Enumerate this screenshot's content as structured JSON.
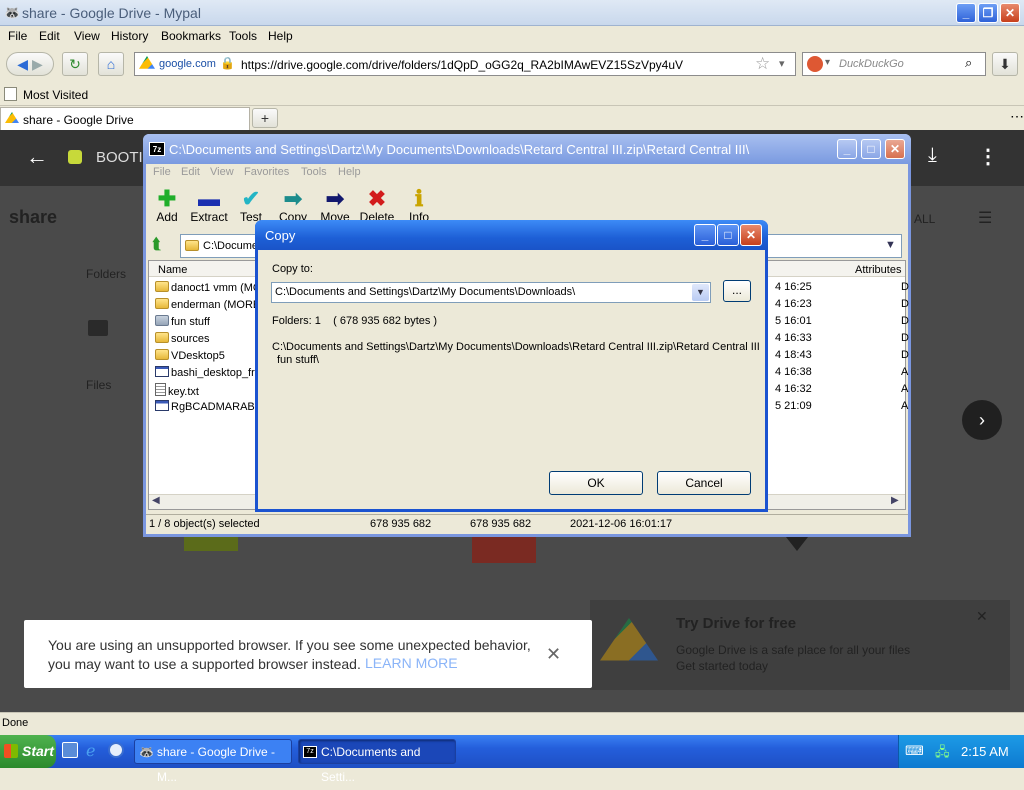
{
  "browser": {
    "window_title": "share - Google Drive - Mypal",
    "menu": [
      "File",
      "Edit",
      "View",
      "History",
      "Bookmarks",
      "Tools",
      "Help"
    ],
    "site_badge": "google.com",
    "url": "https://drive.google.com/drive/folders/1dQpD_oGG2q_RA2bIMAwEVZ15SzVpy4uV",
    "search_placeholder": "DuckDuckGo",
    "bookmark": "Most Visited",
    "tab_title": "share - Google Drive",
    "status": "Done"
  },
  "drive": {
    "folder_title": "BOOTIC",
    "page_title": "share",
    "folders_label": "Folders",
    "files_label": "Files",
    "view_all": "ALL",
    "toast_text": "You are using an unsupported browser. If you see some unexpected behavior, you may want to use a supported browser instead.",
    "toast_link": "LEARN MORE",
    "promo_title": "Try Drive for free",
    "promo_text1": "Google Drive is a safe place for all your files",
    "promo_text2": "Get started today"
  },
  "zip": {
    "title": "C:\\Documents and Settings\\Dartz\\My Documents\\Downloads\\Retard Central III.zip\\Retard Central III\\",
    "menu": [
      "File",
      "Edit",
      "View",
      "Favorites",
      "Tools",
      "Help"
    ],
    "toolbar": [
      "Add",
      "Extract",
      "Test",
      "Copy",
      "Move",
      "Delete",
      "Info"
    ],
    "address": "C:\\Docume",
    "col_name": "Name",
    "col_attributes": "Attributes",
    "rows": [
      {
        "name": "danoct1 vmm (MO",
        "date": "4 16:25",
        "attr": "D",
        "type": "folder"
      },
      {
        "name": "enderman (MORE",
        "date": "4 16:23",
        "attr": "D",
        "type": "folder"
      },
      {
        "name": "fun stuff",
        "date": "5 16:01",
        "attr": "D",
        "type": "folder"
      },
      {
        "name": "sources",
        "date": "4 16:33",
        "attr": "D",
        "type": "folder"
      },
      {
        "name": "VDesktop5",
        "date": "4 18:43",
        "attr": "D",
        "type": "folder"
      },
      {
        "name": "bashi_desktop_fre",
        "date": "4 16:38",
        "attr": "A",
        "type": "app"
      },
      {
        "name": "key.txt",
        "date": "4 16:32",
        "attr": "A",
        "type": "txt"
      },
      {
        "name": "RgBCADMARABIAI",
        "date": "5 21:09",
        "attr": "A",
        "type": "app"
      }
    ],
    "status": {
      "selected": "1 / 8 object(s) selected",
      "size": "678 935 682",
      "packed": "678 935 682",
      "modified": "2021-12-06 16:01:17"
    }
  },
  "dialog": {
    "title": "Copy",
    "copy_to_label": "Copy to:",
    "path": "C:\\Documents and Settings\\Dartz\\My Documents\\Downloads\\",
    "browse": "...",
    "folders_info": "Folders: 1    ( 678 935 682 bytes )",
    "source_line1": "C:\\Documents and Settings\\Dartz\\My Documents\\Downloads\\Retard Central III.zip\\Retard Central III",
    "source_line2": "fun stuff\\",
    "ok": "OK",
    "cancel": "Cancel"
  },
  "taskbar": {
    "start": "Start",
    "items": [
      "share - Google Drive - M...",
      "C:\\Documents and Setti..."
    ],
    "clock": "2:15 AM"
  }
}
